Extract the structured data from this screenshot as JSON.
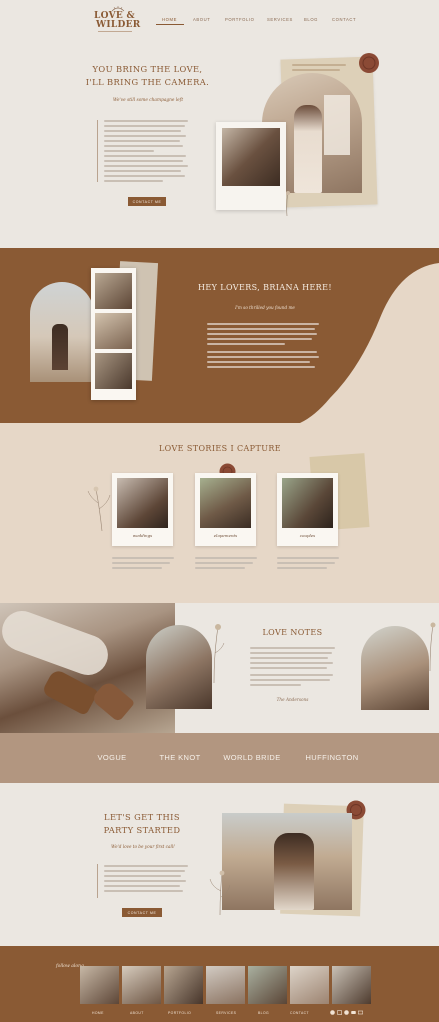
{
  "brand": {
    "name_line1": "LOVE &",
    "name_line2": "WILDER"
  },
  "nav": {
    "items": [
      "HOME",
      "ABOUT",
      "PORTFOLIO",
      "SERVICES",
      "BLOG",
      "CONTACT"
    ],
    "active": "HOME"
  },
  "hero": {
    "headline_line1": "YOU BRING THE LOVE,",
    "headline_line2": "I'LL BRING THE CAMERA.",
    "script_text": "We've still some champagne left",
    "button_label": "CONTACT ME"
  },
  "about": {
    "heading": "HEY LOVERS, BRIANA HERE!",
    "script_text": "I'm so thrilled you found me"
  },
  "stories": {
    "heading": "LOVE STORIES I CAPTURE",
    "captions": [
      "weddings",
      "elopements",
      "couples"
    ]
  },
  "notes": {
    "heading": "LOVE NOTES",
    "signature": "The Andersons"
  },
  "press": {
    "names": [
      "VOGUE",
      "THE KNOT",
      "WORLD BRIDE",
      "HUFFINGTON"
    ]
  },
  "cta": {
    "heading_line1": "LET'S GET THIS",
    "heading_line2": "PARTY STARTED",
    "script_text": "We'd love to be your first call!",
    "button_label": "CONTACT ME"
  },
  "footer": {
    "script_text": "follow along",
    "links": [
      "HOME",
      "ABOUT",
      "PORTFOLIO",
      "SERVICES",
      "BLOG",
      "CONTACT"
    ]
  },
  "colors": {
    "brown": "#8a5a34",
    "cream": "#ebe7e1",
    "tan": "#b29680",
    "sand": "#e6d7c7"
  }
}
